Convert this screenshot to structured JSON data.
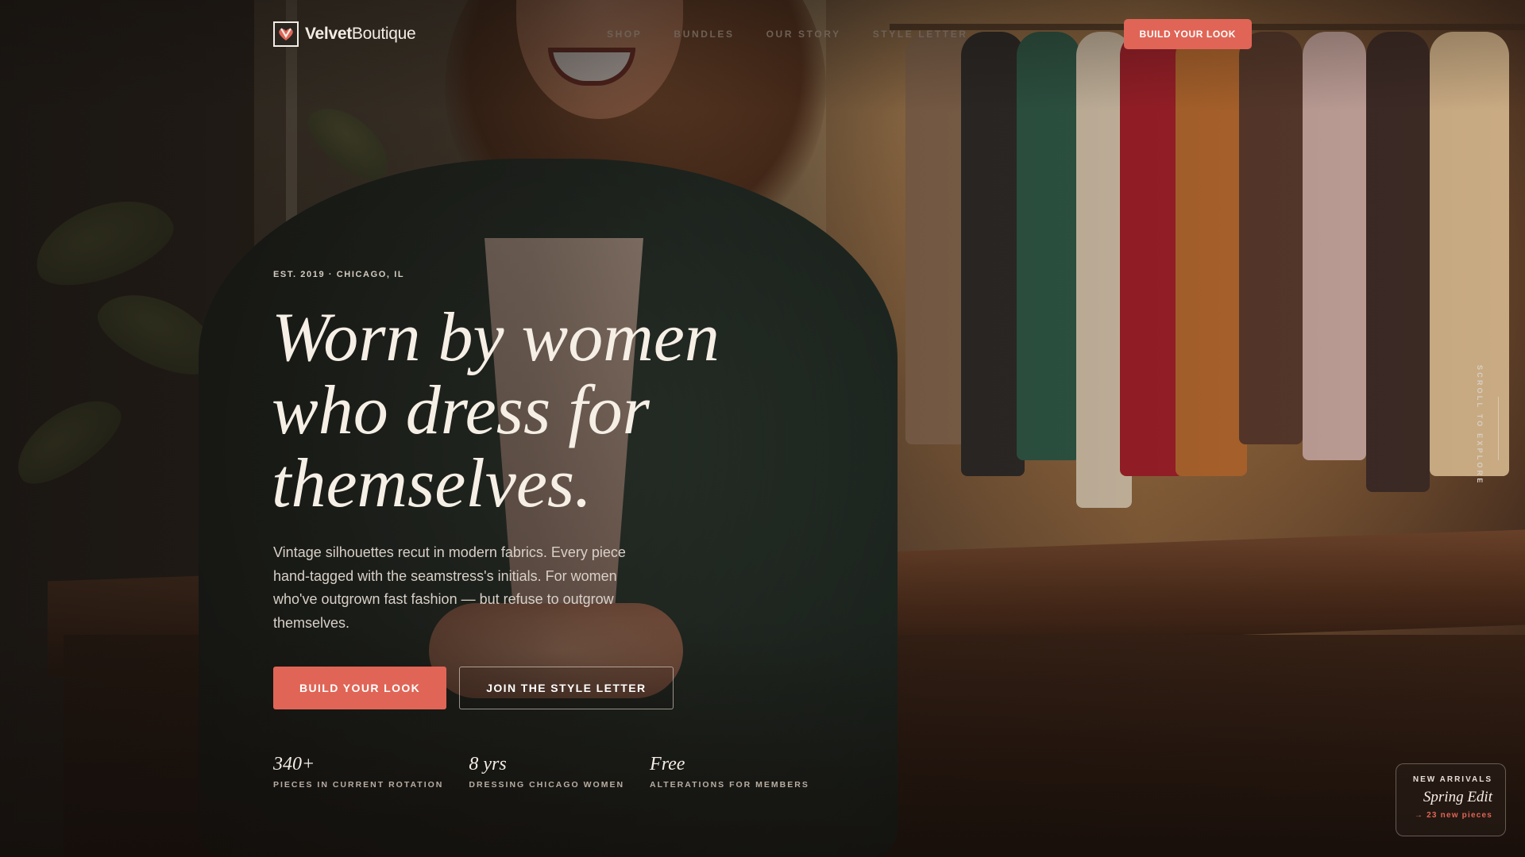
{
  "brand": {
    "name_part1": "Velvet",
    "name_part2": "Boutique",
    "logo_icon": "heart-monogram-icon"
  },
  "nav": {
    "items": [
      {
        "label": "SHOP"
      },
      {
        "label": "BUNDLES"
      },
      {
        "label": "OUR STORY"
      },
      {
        "label": "STYLE LETTER"
      }
    ],
    "cta_label": "BUILD YOUR LOOK"
  },
  "hero": {
    "eyebrow": "EST. 2019 · CHICAGO, IL",
    "headline_lines": [
      "Worn by women",
      "who dress for",
      "themselves."
    ],
    "lede": "Vintage silhouettes recut in modern fabrics. Every piece hand-tagged with the seamstress's initials. For women who've outgrown fast fashion — but refuse to outgrow themselves.",
    "primary_cta": "BUILD YOUR LOOK",
    "secondary_cta": "JOIN THE STYLE LETTER"
  },
  "stats": [
    {
      "value": "340+",
      "label": "PIECES IN CURRENT ROTATION"
    },
    {
      "value": "8 yrs",
      "label": "DRESSING CHICAGO WOMEN"
    },
    {
      "value": "Free",
      "label": "ALTERATIONS FOR MEMBERS"
    }
  ],
  "scroll_cue": "SCROLL TO EXPLORE",
  "arrivals": {
    "eyebrow": "NEW ARRIVALS",
    "title": "Spring Edit",
    "count": "→ 23 new pieces"
  },
  "colors": {
    "accent": "#e06556",
    "text_light": "#f3ece4",
    "nav_muted": "#6e6055"
  }
}
